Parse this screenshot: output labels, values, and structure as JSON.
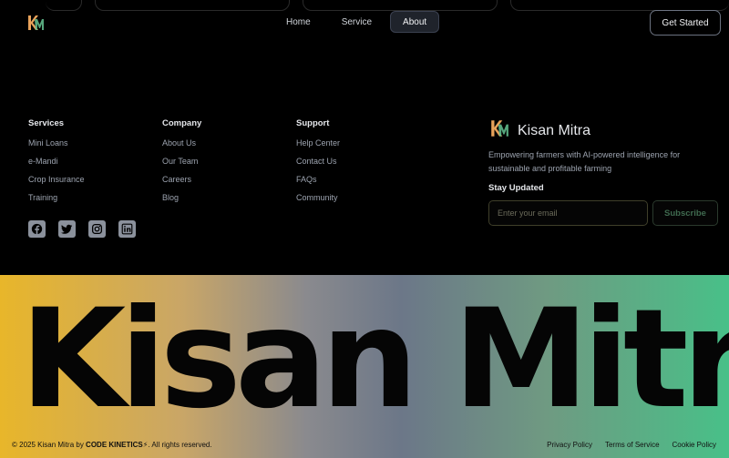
{
  "header": {
    "nav": [
      {
        "label": "Home"
      },
      {
        "label": "Service"
      },
      {
        "label": "About"
      }
    ],
    "active_nav": "About",
    "cta_label": "Get Started"
  },
  "footer": {
    "columns": [
      {
        "title": "Services",
        "links": [
          "Mini Loans",
          "e-Mandi",
          "Crop Insurance",
          "Training"
        ]
      },
      {
        "title": "Company",
        "links": [
          "About Us",
          "Our Team",
          "Careers",
          "Blog"
        ]
      },
      {
        "title": "Support",
        "links": [
          "Help Center",
          "Contact Us",
          "FAQs",
          "Community"
        ]
      }
    ],
    "socials": [
      "facebook-icon",
      "twitter-icon",
      "instagram-icon",
      "linkedin-icon"
    ],
    "brand": {
      "name": "Kisan Mitra",
      "tagline": "Empowering farmers with AI-powered intelligence for sustainable and profitable farming",
      "newsletter_title": "Stay Updated",
      "email_placeholder": "Enter your email",
      "subscribe_label": "Subscribe"
    }
  },
  "band": {
    "big_title": "Kisan Mitra",
    "copyright_prefix": "© 2025 Kisan Mitra by ",
    "company": "CODE KINETICS",
    "copyright_suffix": ". All rights reserved.",
    "legal": [
      "Privacy Policy",
      "Terms of Service",
      "Cookie Policy"
    ]
  },
  "colors": {
    "logo_orange": "#e8a25a",
    "logo_green": "#5fb88a",
    "gradient_start": "#e8b62a",
    "gradient_end": "#48c088"
  }
}
